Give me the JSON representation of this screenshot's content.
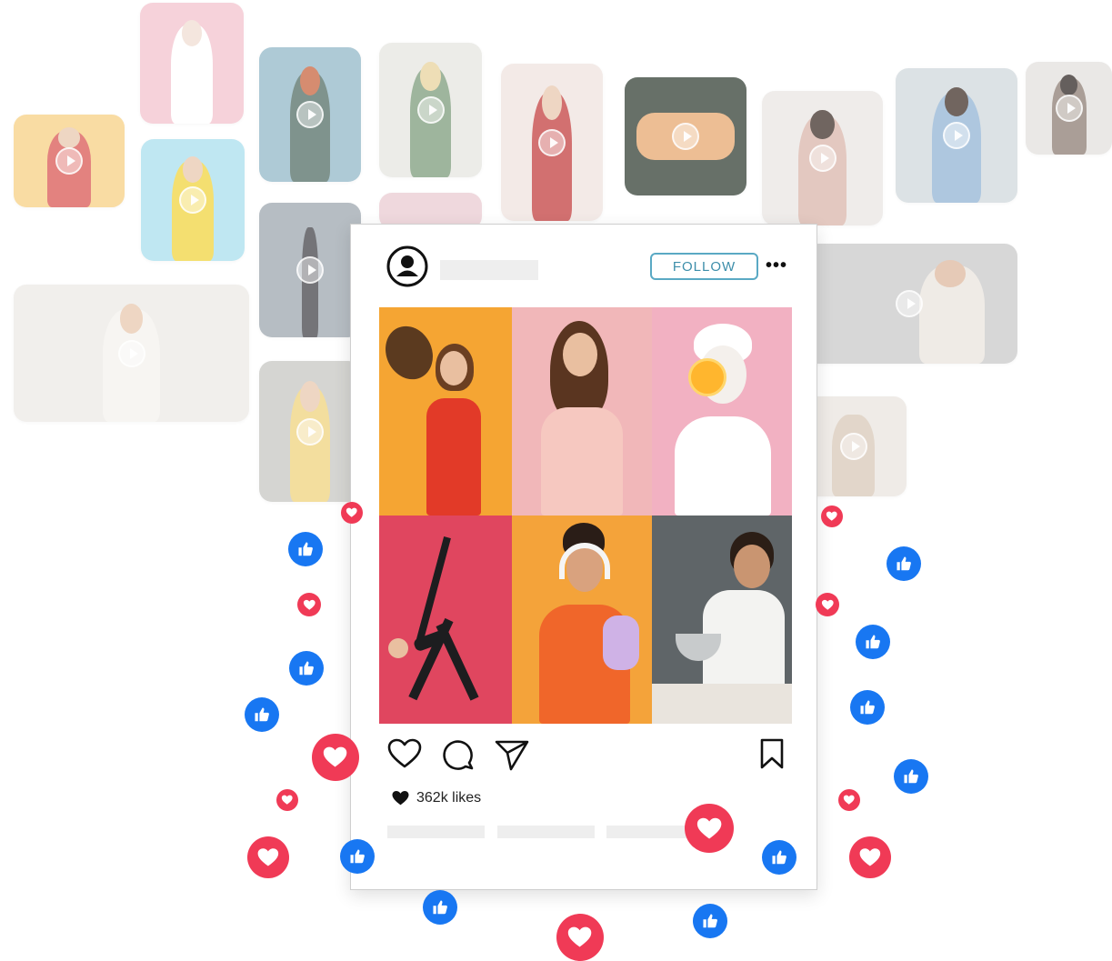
{
  "post": {
    "follow_label": "FOLLOW",
    "more_label": "•••",
    "likes_label": "362k likes"
  },
  "colors": {
    "follow_border": "#5aa9c4",
    "heart_red": "#f03a56",
    "like_blue": "#1877f2"
  },
  "icons": {
    "avatar": "user-circle-icon",
    "like": "heart-outline-icon",
    "comment": "comment-bubble-icon",
    "share": "paper-plane-icon",
    "save": "bookmark-icon",
    "play": "play-icon",
    "reaction_heart": "heart-reaction-icon",
    "reaction_like": "thumbs-up-reaction-icon"
  }
}
